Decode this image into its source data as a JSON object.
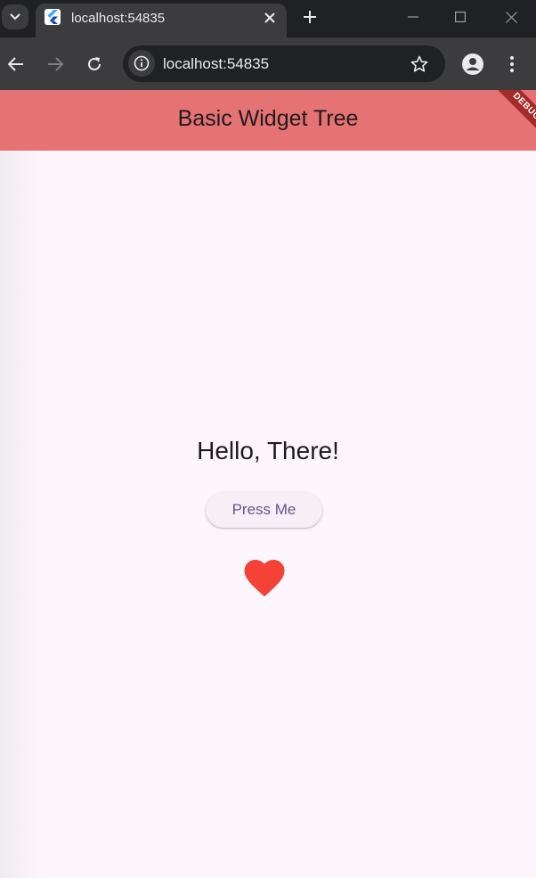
{
  "browser": {
    "tab_title": "localhost:54835",
    "url": "localhost:54835"
  },
  "app": {
    "title": "Basic Widget Tree",
    "debug_label": "DEBUG",
    "greeting": "Hello, There!",
    "button_label": "Press Me",
    "heart_icon": "heart-icon",
    "colors": {
      "appbar": "#e57373",
      "heart": "#f44336",
      "button_text": "#65558f",
      "background": "#fdf7fd"
    }
  }
}
